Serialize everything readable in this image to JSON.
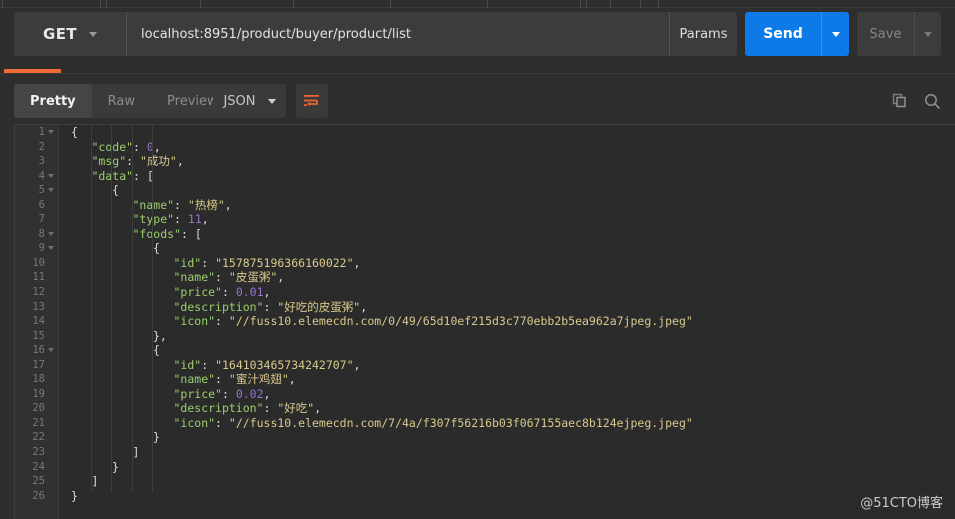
{
  "request": {
    "method": "GET",
    "url": "localhost:8951/product/buyer/product/list",
    "params_label": "Params",
    "send_label": "Send",
    "save_label": "Save"
  },
  "response_toolbar": {
    "tabs": [
      {
        "label": "Pretty",
        "active": true
      },
      {
        "label": "Raw",
        "active": false
      },
      {
        "label": "Preview",
        "active": false
      }
    ],
    "format": "JSON",
    "wrap_icon": "word-wrap-icon",
    "copy_icon": "copy-icon",
    "search_icon": "search-icon"
  },
  "accent_colors": {
    "send_blue": "#0d7ae8",
    "progress_orange": "#f06a33",
    "key_green": "#9bcf6c",
    "string_yellow": "#d8c98c",
    "number_purple": "#9a72d4"
  },
  "response_body": {
    "code": 0,
    "msg": "成功",
    "data": [
      {
        "name": "热榜",
        "type": 11,
        "foods": [
          {
            "id": "157875196366160022",
            "name": "皮蛋粥",
            "price": 0.01,
            "description": "好吃的皮蛋粥",
            "icon": "//fuss10.elemecdn.com/0/49/65d10ef215d3c770ebb2b5ea962a7jpeg.jpeg"
          },
          {
            "id": "164103465734242707",
            "name": "蜜汁鸡翅",
            "price": 0.02,
            "description": "好吃",
            "icon": "//fuss10.elemecdn.com/7/4a/f307f56216b03f067155aec8b124ejpeg.jpeg"
          }
        ]
      }
    ]
  },
  "code_lines": [
    {
      "n": 1,
      "fold": true,
      "indent": 0,
      "tokens": [
        {
          "t": "{",
          "c": "p"
        }
      ]
    },
    {
      "n": 2,
      "fold": false,
      "indent": 1,
      "tokens": [
        {
          "t": "\"code\"",
          "c": "k"
        },
        {
          "t": ": ",
          "c": "p"
        },
        {
          "t": "0",
          "c": "n"
        },
        {
          "t": ",",
          "c": "p"
        }
      ]
    },
    {
      "n": 3,
      "fold": false,
      "indent": 1,
      "tokens": [
        {
          "t": "\"msg\"",
          "c": "k"
        },
        {
          "t": ": ",
          "c": "p"
        },
        {
          "t": "\"成功\"",
          "c": "s"
        },
        {
          "t": ",",
          "c": "p"
        }
      ]
    },
    {
      "n": 4,
      "fold": true,
      "indent": 1,
      "tokens": [
        {
          "t": "\"data\"",
          "c": "k"
        },
        {
          "t": ": [",
          "c": "p"
        }
      ]
    },
    {
      "n": 5,
      "fold": true,
      "indent": 2,
      "tokens": [
        {
          "t": "{",
          "c": "p"
        }
      ]
    },
    {
      "n": 6,
      "fold": false,
      "indent": 3,
      "tokens": [
        {
          "t": "\"name\"",
          "c": "k"
        },
        {
          "t": ": ",
          "c": "p"
        },
        {
          "t": "\"热榜\"",
          "c": "s"
        },
        {
          "t": ",",
          "c": "p"
        }
      ]
    },
    {
      "n": 7,
      "fold": false,
      "indent": 3,
      "tokens": [
        {
          "t": "\"type\"",
          "c": "k"
        },
        {
          "t": ": ",
          "c": "p"
        },
        {
          "t": "11",
          "c": "n"
        },
        {
          "t": ",",
          "c": "p"
        }
      ]
    },
    {
      "n": 8,
      "fold": true,
      "indent": 3,
      "tokens": [
        {
          "t": "\"foods\"",
          "c": "k"
        },
        {
          "t": ": [",
          "c": "p"
        }
      ]
    },
    {
      "n": 9,
      "fold": true,
      "indent": 4,
      "tokens": [
        {
          "t": "{",
          "c": "p"
        }
      ]
    },
    {
      "n": 10,
      "fold": false,
      "indent": 5,
      "tokens": [
        {
          "t": "\"id\"",
          "c": "k"
        },
        {
          "t": ": ",
          "c": "p"
        },
        {
          "t": "\"157875196366160022\"",
          "c": "s"
        },
        {
          "t": ",",
          "c": "p"
        }
      ]
    },
    {
      "n": 11,
      "fold": false,
      "indent": 5,
      "tokens": [
        {
          "t": "\"name\"",
          "c": "k"
        },
        {
          "t": ": ",
          "c": "p"
        },
        {
          "t": "\"皮蛋粥\"",
          "c": "s"
        },
        {
          "t": ",",
          "c": "p"
        }
      ]
    },
    {
      "n": 12,
      "fold": false,
      "indent": 5,
      "tokens": [
        {
          "t": "\"price\"",
          "c": "k"
        },
        {
          "t": ": ",
          "c": "p"
        },
        {
          "t": "0.01",
          "c": "n"
        },
        {
          "t": ",",
          "c": "p"
        }
      ]
    },
    {
      "n": 13,
      "fold": false,
      "indent": 5,
      "tokens": [
        {
          "t": "\"description\"",
          "c": "k"
        },
        {
          "t": ": ",
          "c": "p"
        },
        {
          "t": "\"好吃的皮蛋粥\"",
          "c": "s"
        },
        {
          "t": ",",
          "c": "p"
        }
      ]
    },
    {
      "n": 14,
      "fold": false,
      "indent": 5,
      "tokens": [
        {
          "t": "\"icon\"",
          "c": "k"
        },
        {
          "t": ": ",
          "c": "p"
        },
        {
          "t": "\"//fuss10.elemecdn.com/0/49/65d10ef215d3c770ebb2b5ea962a7jpeg.jpeg\"",
          "c": "s"
        }
      ]
    },
    {
      "n": 15,
      "fold": false,
      "indent": 4,
      "tokens": [
        {
          "t": "},",
          "c": "p"
        }
      ]
    },
    {
      "n": 16,
      "fold": true,
      "indent": 4,
      "tokens": [
        {
          "t": "{",
          "c": "p"
        }
      ]
    },
    {
      "n": 17,
      "fold": false,
      "indent": 5,
      "tokens": [
        {
          "t": "\"id\"",
          "c": "k"
        },
        {
          "t": ": ",
          "c": "p"
        },
        {
          "t": "\"164103465734242707\"",
          "c": "s"
        },
        {
          "t": ",",
          "c": "p"
        }
      ]
    },
    {
      "n": 18,
      "fold": false,
      "indent": 5,
      "tokens": [
        {
          "t": "\"name\"",
          "c": "k"
        },
        {
          "t": ": ",
          "c": "p"
        },
        {
          "t": "\"蜜汁鸡翅\"",
          "c": "s"
        },
        {
          "t": ",",
          "c": "p"
        }
      ]
    },
    {
      "n": 19,
      "fold": false,
      "indent": 5,
      "tokens": [
        {
          "t": "\"price\"",
          "c": "k"
        },
        {
          "t": ": ",
          "c": "p"
        },
        {
          "t": "0.02",
          "c": "n"
        },
        {
          "t": ",",
          "c": "p"
        }
      ]
    },
    {
      "n": 20,
      "fold": false,
      "indent": 5,
      "tokens": [
        {
          "t": "\"description\"",
          "c": "k"
        },
        {
          "t": ": ",
          "c": "p"
        },
        {
          "t": "\"好吃\"",
          "c": "s"
        },
        {
          "t": ",",
          "c": "p"
        }
      ]
    },
    {
      "n": 21,
      "fold": false,
      "indent": 5,
      "tokens": [
        {
          "t": "\"icon\"",
          "c": "k"
        },
        {
          "t": ": ",
          "c": "p"
        },
        {
          "t": "\"//fuss10.elemecdn.com/7/4a/f307f56216b03f067155aec8b124ejpeg.jpeg\"",
          "c": "s"
        }
      ]
    },
    {
      "n": 22,
      "fold": false,
      "indent": 4,
      "tokens": [
        {
          "t": "}",
          "c": "p"
        }
      ]
    },
    {
      "n": 23,
      "fold": false,
      "indent": 3,
      "tokens": [
        {
          "t": "]",
          "c": "p"
        }
      ]
    },
    {
      "n": 24,
      "fold": false,
      "indent": 2,
      "tokens": [
        {
          "t": "}",
          "c": "p"
        }
      ]
    },
    {
      "n": 25,
      "fold": false,
      "indent": 1,
      "tokens": [
        {
          "t": "]",
          "c": "p"
        }
      ]
    },
    {
      "n": 26,
      "fold": false,
      "indent": 0,
      "tokens": [
        {
          "t": "}",
          "c": "p"
        }
      ]
    }
  ],
  "watermark": "@51CTO博客"
}
